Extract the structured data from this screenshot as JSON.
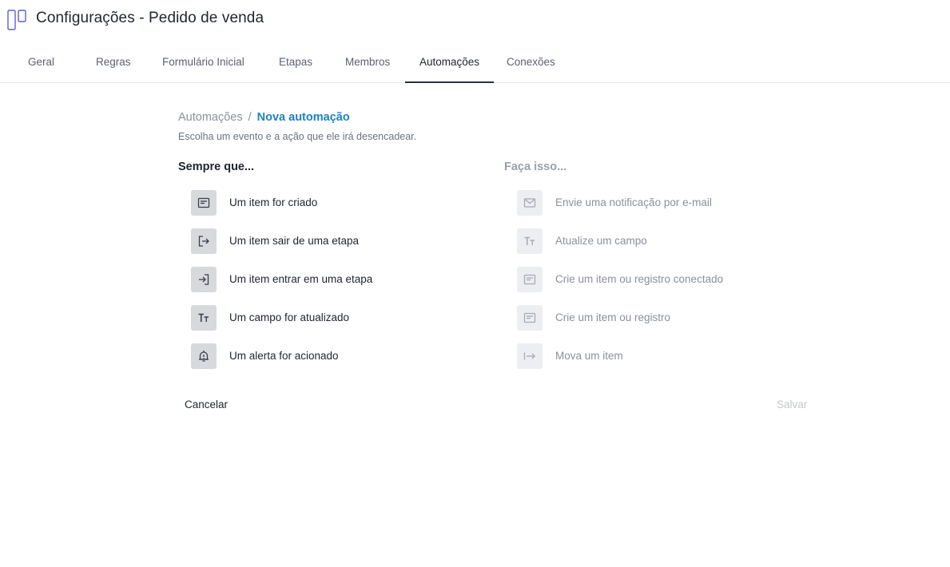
{
  "header": {
    "title": "Configurações - Pedido de venda"
  },
  "tabs": [
    {
      "label": "Geral"
    },
    {
      "label": "Regras"
    },
    {
      "label": "Formulário Inicial"
    },
    {
      "label": "Etapas"
    },
    {
      "label": "Membros"
    },
    {
      "label": "Automações",
      "active": true
    },
    {
      "label": "Conexões"
    }
  ],
  "breadcrumb": {
    "parent": "Automações",
    "separator": "/",
    "current": "Nova automação"
  },
  "subtitle": "Escolha um evento e a ação que ele irá desencadear.",
  "triggers": {
    "title": "Sempre que...",
    "items": [
      {
        "label": "Um item for criado",
        "icon": "card-icon"
      },
      {
        "label": "Um item sair de uma etapa",
        "icon": "exit-icon"
      },
      {
        "label": "Um item entrar em uma etapa",
        "icon": "enter-icon"
      },
      {
        "label": "Um campo for atualizado",
        "icon": "text-field-icon"
      },
      {
        "label": "Um alerta for acionado",
        "icon": "alert-bell-icon"
      }
    ]
  },
  "actions": {
    "title": "Faça isso...",
    "items": [
      {
        "label": "Envie uma notificação por e-mail",
        "icon": "mail-icon"
      },
      {
        "label": "Atualize um campo",
        "icon": "text-field-icon"
      },
      {
        "label": "Crie um item ou registro conectado",
        "icon": "card-icon"
      },
      {
        "label": "Crie um item ou registro",
        "icon": "card-icon"
      },
      {
        "label": "Mova um item",
        "icon": "move-icon"
      }
    ]
  },
  "footer": {
    "cancel": "Cancelar",
    "save": "Salvar"
  },
  "colors": {
    "accent": "#1a84c7",
    "logo": "#5b5fd6",
    "text": "#1f2430",
    "muted": "#8a909c"
  }
}
